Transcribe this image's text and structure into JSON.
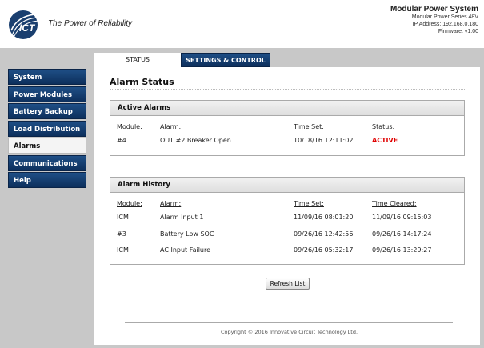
{
  "header": {
    "tagline": "The Power of Reliability",
    "system_title": "Modular Power System",
    "series": "Modular Power Series 48V",
    "ip": "IP Address: 192.168.0.180",
    "firmware": "Firmware: v1.00"
  },
  "tabs": [
    {
      "label": "STATUS"
    },
    {
      "label": "SETTINGS & CONTROL"
    }
  ],
  "sidebar": {
    "items": [
      {
        "label": "System"
      },
      {
        "label": "Power Modules"
      },
      {
        "label": "Battery Backup"
      },
      {
        "label": "Load Distribution"
      },
      {
        "label": "Alarms"
      },
      {
        "label": "Communications"
      },
      {
        "label": "Help"
      }
    ]
  },
  "main": {
    "title": "Alarm Status",
    "active": {
      "heading": "Active Alarms",
      "columns": [
        "Module:",
        "Alarm:",
        "Time Set:",
        "Status:"
      ],
      "rows": [
        {
          "module": "#4",
          "alarm": "OUT #2 Breaker Open",
          "time": "10/18/16 12:11:02",
          "status": "ACTIVE"
        }
      ]
    },
    "history": {
      "heading": "Alarm History",
      "columns": [
        "Module:",
        "Alarm:",
        "Time Set:",
        "Time Cleared:"
      ],
      "rows": [
        {
          "module": "ICM",
          "alarm": "Alarm Input 1",
          "time": "11/09/16 08:01:20",
          "cleared": "11/09/16 09:15:03"
        },
        {
          "module": "#3",
          "alarm": "Battery Low SOC",
          "time": "09/26/16 12:42:56",
          "cleared": "09/26/16 14:17:24"
        },
        {
          "module": "ICM",
          "alarm": "AC Input Failure",
          "time": "09/26/16 05:32:17",
          "cleared": "09/26/16 13:29:27"
        }
      ]
    },
    "refresh_label": "Refresh List"
  },
  "footer": {
    "copyright": "Copyright © 2016 Innovative Circuit Technology Ltd."
  },
  "colors": {
    "nav_blue": "#0d2f5c",
    "active_red": "#e00000"
  }
}
